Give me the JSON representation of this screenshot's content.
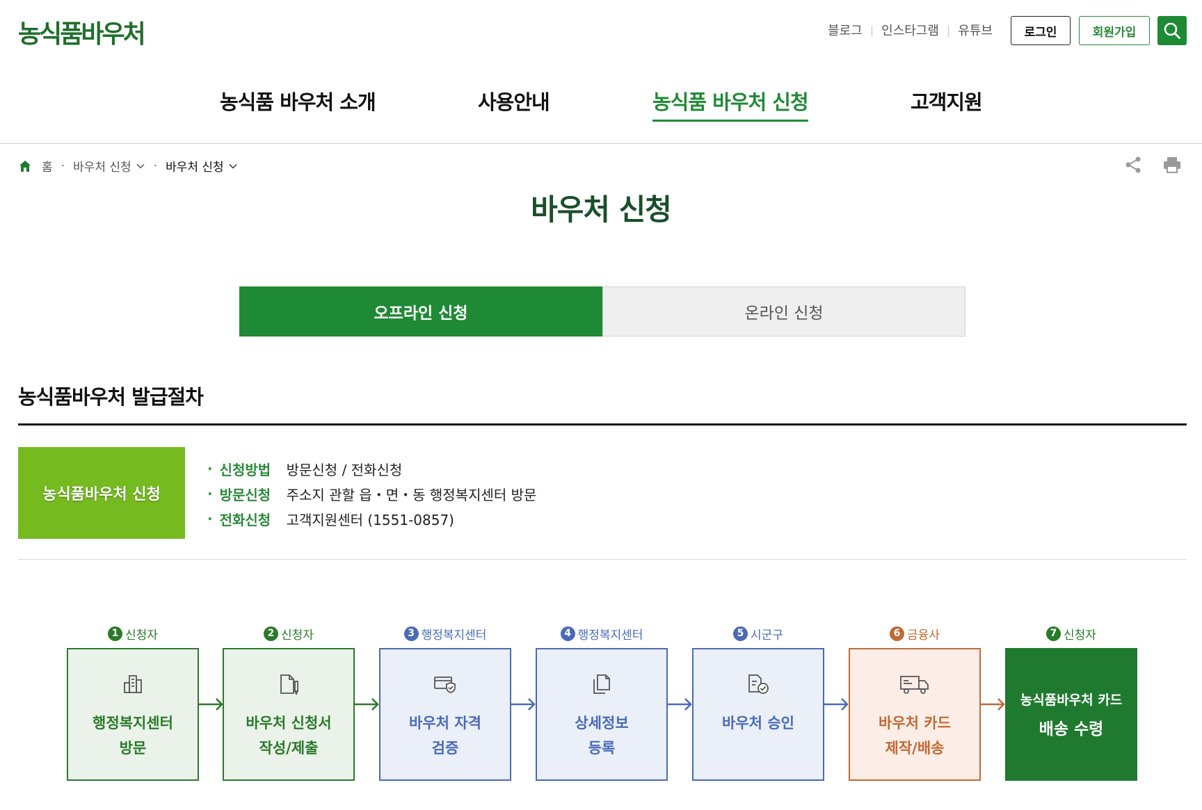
{
  "header": {
    "logo": "농식품바우처",
    "util_links": [
      "블로그",
      "인스타그램",
      "유튜브"
    ],
    "login_label": "로그인",
    "join_label": "회원가입"
  },
  "nav": {
    "items": [
      {
        "label": "농식품 바우처 소개",
        "active": false
      },
      {
        "label": "사용안내",
        "active": false
      },
      {
        "label": "농식품 바우처 신청",
        "active": true
      },
      {
        "label": "고객지원",
        "active": false
      }
    ]
  },
  "breadcrumb": {
    "home": "홈",
    "level1": "바우처 신청",
    "level2": "바우처 신청"
  },
  "page_title": "바우처 신청",
  "tabs": [
    {
      "label": "오프라인 신청",
      "selected": true
    },
    {
      "label": "온라인 신청",
      "selected": false
    }
  ],
  "section": {
    "title": "농식품바우처 발급절차",
    "apply_box": "농식품바우처 신청",
    "info": [
      {
        "label": "신청방법",
        "value": "방문신청 / 전화신청"
      },
      {
        "label": "방문신청",
        "value": "주소지 관할 읍・면・동 행정복지센터 방문"
      },
      {
        "label": "전화신청",
        "value": "고객지원센터 (1551-0857)"
      }
    ]
  },
  "steps": [
    {
      "num": "1",
      "actor": "신청자",
      "line1": "행정복지센터",
      "line2": "방문",
      "icon": "building-icon",
      "color": "#2a7a2a"
    },
    {
      "num": "2",
      "actor": "신청자",
      "line1": "바우처 신청서",
      "line2": "작성/제출",
      "icon": "document-pen-icon",
      "color": "#2a7a2a"
    },
    {
      "num": "3",
      "actor": "행정복지센터",
      "line1": "바우처 자격",
      "line2": "검증",
      "icon": "card-shield-icon",
      "color": "#4a6ab8"
    },
    {
      "num": "4",
      "actor": "행정복지센터",
      "line1": "상세정보",
      "line2": "등록",
      "icon": "documents-icon",
      "color": "#4a6ab8"
    },
    {
      "num": "5",
      "actor": "시군구",
      "line1": "바우처 승인",
      "line2": "",
      "icon": "document-check-icon",
      "color": "#4a6ab8"
    },
    {
      "num": "6",
      "actor": "금융사",
      "line1": "바우처 카드",
      "line2": "제작/배송",
      "icon": "delivery-truck-icon",
      "color": "#c06a35"
    },
    {
      "num": "7",
      "actor": "신청자",
      "line1": "농식품바우처 카드",
      "line2": "배송 수령",
      "icon": "",
      "color": "#1f7a30"
    }
  ]
}
